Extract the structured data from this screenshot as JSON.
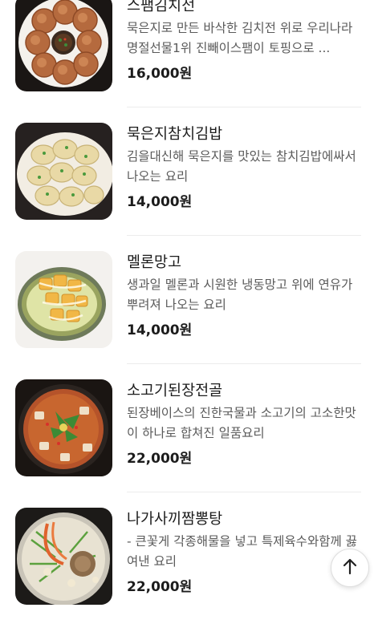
{
  "menu": {
    "items": [
      {
        "name": "스팸김치전",
        "description": "묵은지로 만든 바삭한 김치전 위로 우리나라 명절선물1위 진빼이스팸이 토핑으로 ...",
        "price": "16,000원",
        "image_icon": "kimchi-pancake-photo"
      },
      {
        "name": "묵은지참치김밥",
        "description": "김을대신해 묵은지를 맛있는 참치김밥에싸서 나오는 요리",
        "price": "14,000원",
        "image_icon": "kimbap-photo"
      },
      {
        "name": "멜론망고",
        "description": "생과일 멜론과 시원한 냉동망고 위에 연유가뿌려져 나오는 요리",
        "price": "14,000원",
        "image_icon": "melon-mango-photo"
      },
      {
        "name": "소고기된장전골",
        "description": "된장베이스의 진한국물과 소고기의 고소한맛이 하나로 합쳐진 일품요리",
        "price": "22,000원",
        "image_icon": "doenjang-stew-photo"
      },
      {
        "name": "나가사끼짬뽕탕",
        "description": "- 큰꽃게 각종해물을 넣고 특제육수와함께 끓여낸 요리",
        "price": "22,000원",
        "image_icon": "jjamppong-photo"
      }
    ]
  },
  "scroll_top_button": {
    "icon": "arrow-up-icon"
  }
}
